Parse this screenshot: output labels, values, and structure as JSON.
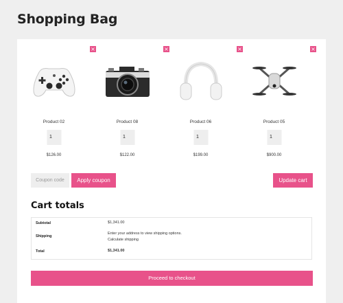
{
  "page": {
    "title": "Shopping Bag"
  },
  "remove_glyph": "×",
  "products": [
    {
      "name": "Product 02",
      "qty": "1",
      "price": "$126.00",
      "icon": "game-controller-icon"
    },
    {
      "name": "Product 08",
      "qty": "1",
      "price": "$122.00",
      "icon": "camera-icon"
    },
    {
      "name": "Product 06",
      "qty": "1",
      "price": "$199.00",
      "icon": "headphones-icon"
    },
    {
      "name": "Product 05",
      "qty": "1",
      "price": "$900.00",
      "icon": "drone-icon"
    }
  ],
  "coupon": {
    "placeholder": "Coupon code",
    "apply_label": "Apply coupon"
  },
  "update_label": "Update cart",
  "totals": {
    "title": "Cart totals",
    "subtotal_label": "Subtotal",
    "subtotal_value": "$1,341.00",
    "shipping_label": "Shipping",
    "shipping_text": "Enter your address to view shipping options.",
    "shipping_link": "Calculate shipping",
    "total_label": "Total",
    "total_value": "$1,341.00"
  },
  "checkout_label": "Proceed to checkout",
  "colors": {
    "accent": "#e8528a",
    "background": "#efefef",
    "card": "#ffffff"
  }
}
